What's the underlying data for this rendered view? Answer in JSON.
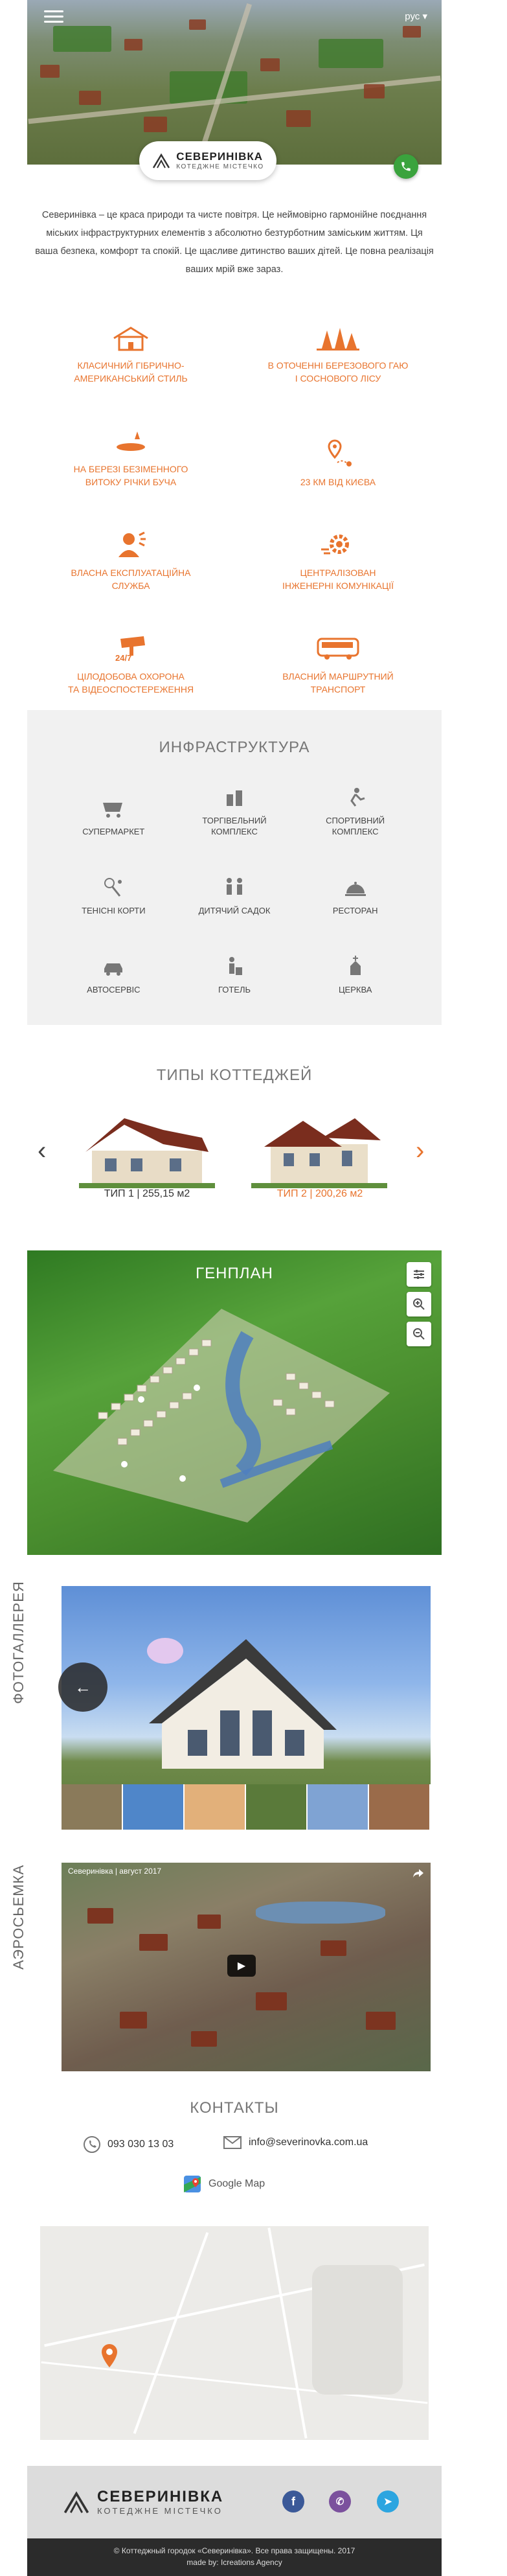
{
  "header": {
    "lang": "рус ▾"
  },
  "logo": {
    "name": "СЕВЕРИНІВКА",
    "subtitle": "КОТЕДЖНЕ МІСТЕЧКО"
  },
  "intro": "Северинівка – це краса природи та чисте повітря. Це неймовірно гармонійне поєднання міських інфраструктурних елементів з абсолютно безтурботним заміським життям. Ця ваша безпека, комфорт та спокій. Це щасливе дитинство ваших дітей. Це повна реалізація ваших мрій вже зараз.",
  "features": [
    {
      "icon": "house-icon",
      "label": "КЛАСИЧНИЙ ГІБРИЧНО-\nАМЕРИКАНСЬКИЙ СТИЛЬ"
    },
    {
      "icon": "forest-icon",
      "label": "В ОТОЧЕННІ БЕРЕЗОВОГО ГАЮ\nІ СОСНОВОГО ЛІСУ"
    },
    {
      "icon": "lake-icon",
      "label": "НА БЕРЕЗІ БЕЗІМЕННОГО\nВИТОКУ РІЧКИ БУЧА"
    },
    {
      "icon": "location-icon",
      "label": "23 КМ ВІД КИЄВА"
    },
    {
      "icon": "service-staff-icon",
      "label": "ВЛАСНА ЕКСПЛУАТАЦІЙНА\nСЛУЖБА"
    },
    {
      "icon": "gear-icon",
      "label": "ЦЕНТРАЛІЗОВАН\nІНЖЕНЕРНІ КОМУНІКАЦІЇ"
    },
    {
      "icon": "camera-24-7-icon",
      "label": "ЦІЛОДОБОВА ОХОРОНА\nТА ВІДЕОСПОСТЕРЕЖЕННЯ"
    },
    {
      "icon": "bus-icon",
      "label": "ВЛАСНИЙ МАРШРУТНИЙ\nТРАНСПОРТ"
    }
  ],
  "infra": {
    "title": "ИНФРАСТРУКТУРА",
    "items": [
      {
        "icon": "supermarket-icon",
        "label": "СУПЕРМАРКЕТ"
      },
      {
        "icon": "mall-icon",
        "label": "ТОРГІВЕЛЬНИЙ\nКОМПЛЕКС"
      },
      {
        "icon": "sports-icon",
        "label": "СПОРТИВНИЙ\nКОМПЛЕКС"
      },
      {
        "icon": "tennis-icon",
        "label": "ТЕНІСНІ КОРТИ"
      },
      {
        "icon": "kindergarten-icon",
        "label": "ДИТЯЧИЙ САДОК"
      },
      {
        "icon": "restaurant-icon",
        "label": "РЕСТОРАН"
      },
      {
        "icon": "car-service-icon",
        "label": "АВТОСЕРВІС"
      },
      {
        "icon": "hotel-icon",
        "label": "ГОТЕЛЬ"
      },
      {
        "icon": "church-icon",
        "label": "ЦЕРКВА"
      }
    ]
  },
  "types": {
    "title": "ТИПЫ КОТТЕДЖЕЙ",
    "items": [
      {
        "name": "ТИП 1",
        "sep": "|",
        "area": "255,15 м2"
      },
      {
        "name": "ТИП 2",
        "sep": "|",
        "area": "200,26 м2"
      }
    ]
  },
  "genplan": {
    "title": "ГЕНПЛАН"
  },
  "gallery": {
    "label": "ФОТОГАЛЛЕРЕЯ"
  },
  "aerial": {
    "label": "АЭРОСЬЕМКА",
    "video_title": "Северинівка | август 2017"
  },
  "contacts": {
    "title": "КОНТАКТЫ",
    "phone": "093 030 13 03",
    "email": "info@severinovka.com.ua",
    "map_link": "Google Map"
  },
  "footer": {
    "copyright": "© Коттеджный городок «Северинівка». Все права защищены. 2017",
    "made_by": "made by:  Icreations Agency"
  },
  "colors": {
    "accent": "#e8742e",
    "infra_bg": "#f1f1f1",
    "footer_dark": "#2b2b2b"
  }
}
